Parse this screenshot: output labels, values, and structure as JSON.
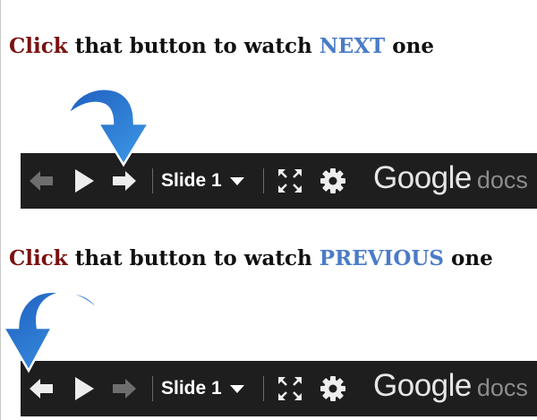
{
  "instructions": {
    "next": {
      "click": "Click",
      "middle": " that button to watch ",
      "keyword": "NEXT",
      "end": " one"
    },
    "previous": {
      "click": "Click",
      "middle": " that button to watch ",
      "keyword": "PREVIOUS",
      "end": " one"
    }
  },
  "toolbars": [
    {
      "slide_label": "Slide 1",
      "brand": "Google",
      "product": "docs",
      "prev_enabled": false,
      "next_enabled": true
    },
    {
      "slide_label": "Slide 1",
      "brand": "Google",
      "product": "docs",
      "prev_enabled": true,
      "next_enabled": false
    }
  ],
  "colors": {
    "click_word": "#7a1010",
    "keyword": "#4a7cc7",
    "toolbar_bg": "#1e1e1e",
    "pointer_arrow": "#2f7fd8",
    "disabled_icon": "#7a7a7a"
  },
  "icons": [
    "prev-slide-icon",
    "play-icon",
    "next-slide-icon",
    "dropdown-caret-icon",
    "fullscreen-icon",
    "gear-icon",
    "pointer-arrow-icon"
  ]
}
